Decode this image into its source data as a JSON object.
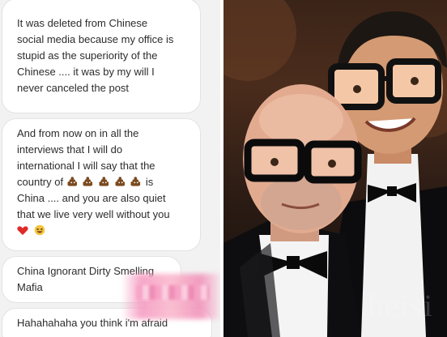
{
  "messages": [
    {
      "text": "It was deleted from Chinese\nsocial media because my office is\nstupid as the superiority of the\nChinese .... it was by my will I\nnever canceled the post"
    },
    {
      "text_before": "And from now on in all the\ninterviews that I will do\ninternational I will say that the\ncountry of ",
      "emoji_name": "pile-of-poo-icon",
      "text_mid": " is",
      "text_after": "China .... and you are also quiet\nthat we live very well without you",
      "reactions": [
        "heart-icon",
        "grinning-squinting-face-icon"
      ]
    },
    {
      "text": "China Ignorant Dirty Smelling\nMafia"
    },
    {
      "text": "Hahahahaha you think i'm afraid"
    }
  ],
  "photo": {
    "watermark": "heisi"
  },
  "colors": {
    "chat_bg": "#f2f2f2",
    "bubble_bg": "#ffffff",
    "text": "#2c2c2c",
    "censor_pink": "#f0a3c4"
  }
}
